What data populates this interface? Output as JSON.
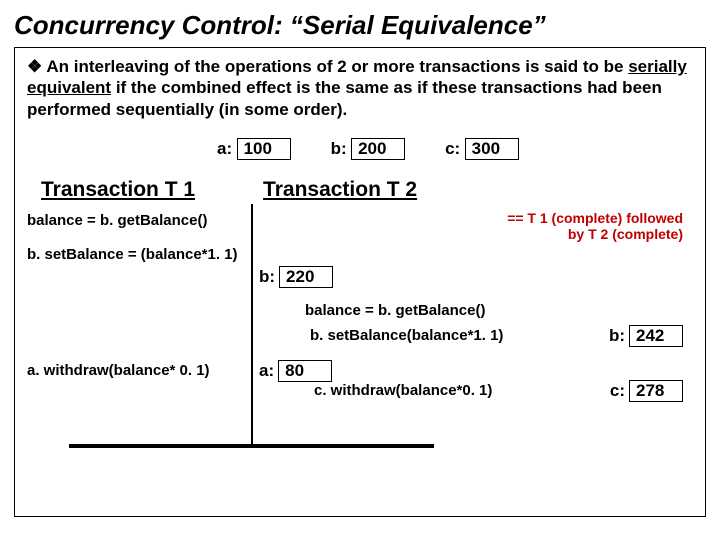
{
  "title": "Concurrency Control: “Serial Equivalence”",
  "bullet": "❖ An interleaving of the operations of 2 or more transactions is said to be ",
  "bullet_serial": "serially equivalent",
  "bullet_rest": " if the combined effect is the same as if these transactions had been performed sequentially (in some order).",
  "vars": {
    "a_label": "a:",
    "a_val": "100",
    "b_label": "b:",
    "b_val": "200",
    "c_label": "c:",
    "c_val": "300"
  },
  "tx1_header": "Transaction T 1",
  "tx2_header": "Transaction T 2",
  "note_line1": "== T 1 (complete) followed",
  "note_line2": "by T 2 (complete)",
  "t1_line1": "balance = b. getBalance()",
  "t1_line2": "b. setBalance = (balance*1. 1)",
  "t1_line3": "a. withdraw(balance* 0. 1)",
  "mid_b_label": "b:",
  "mid_b_val": "220",
  "t2_line1": "balance = b. getBalance()",
  "t2_line2": "b. setBalance(balance*1. 1)",
  "mid_a_label": "a:",
  "mid_a_val": "80",
  "t2_line3": "c. withdraw(balance*0. 1)",
  "r_b_label": "b:",
  "r_b_val": "242",
  "r_c_label": "c:",
  "r_c_val": "278"
}
